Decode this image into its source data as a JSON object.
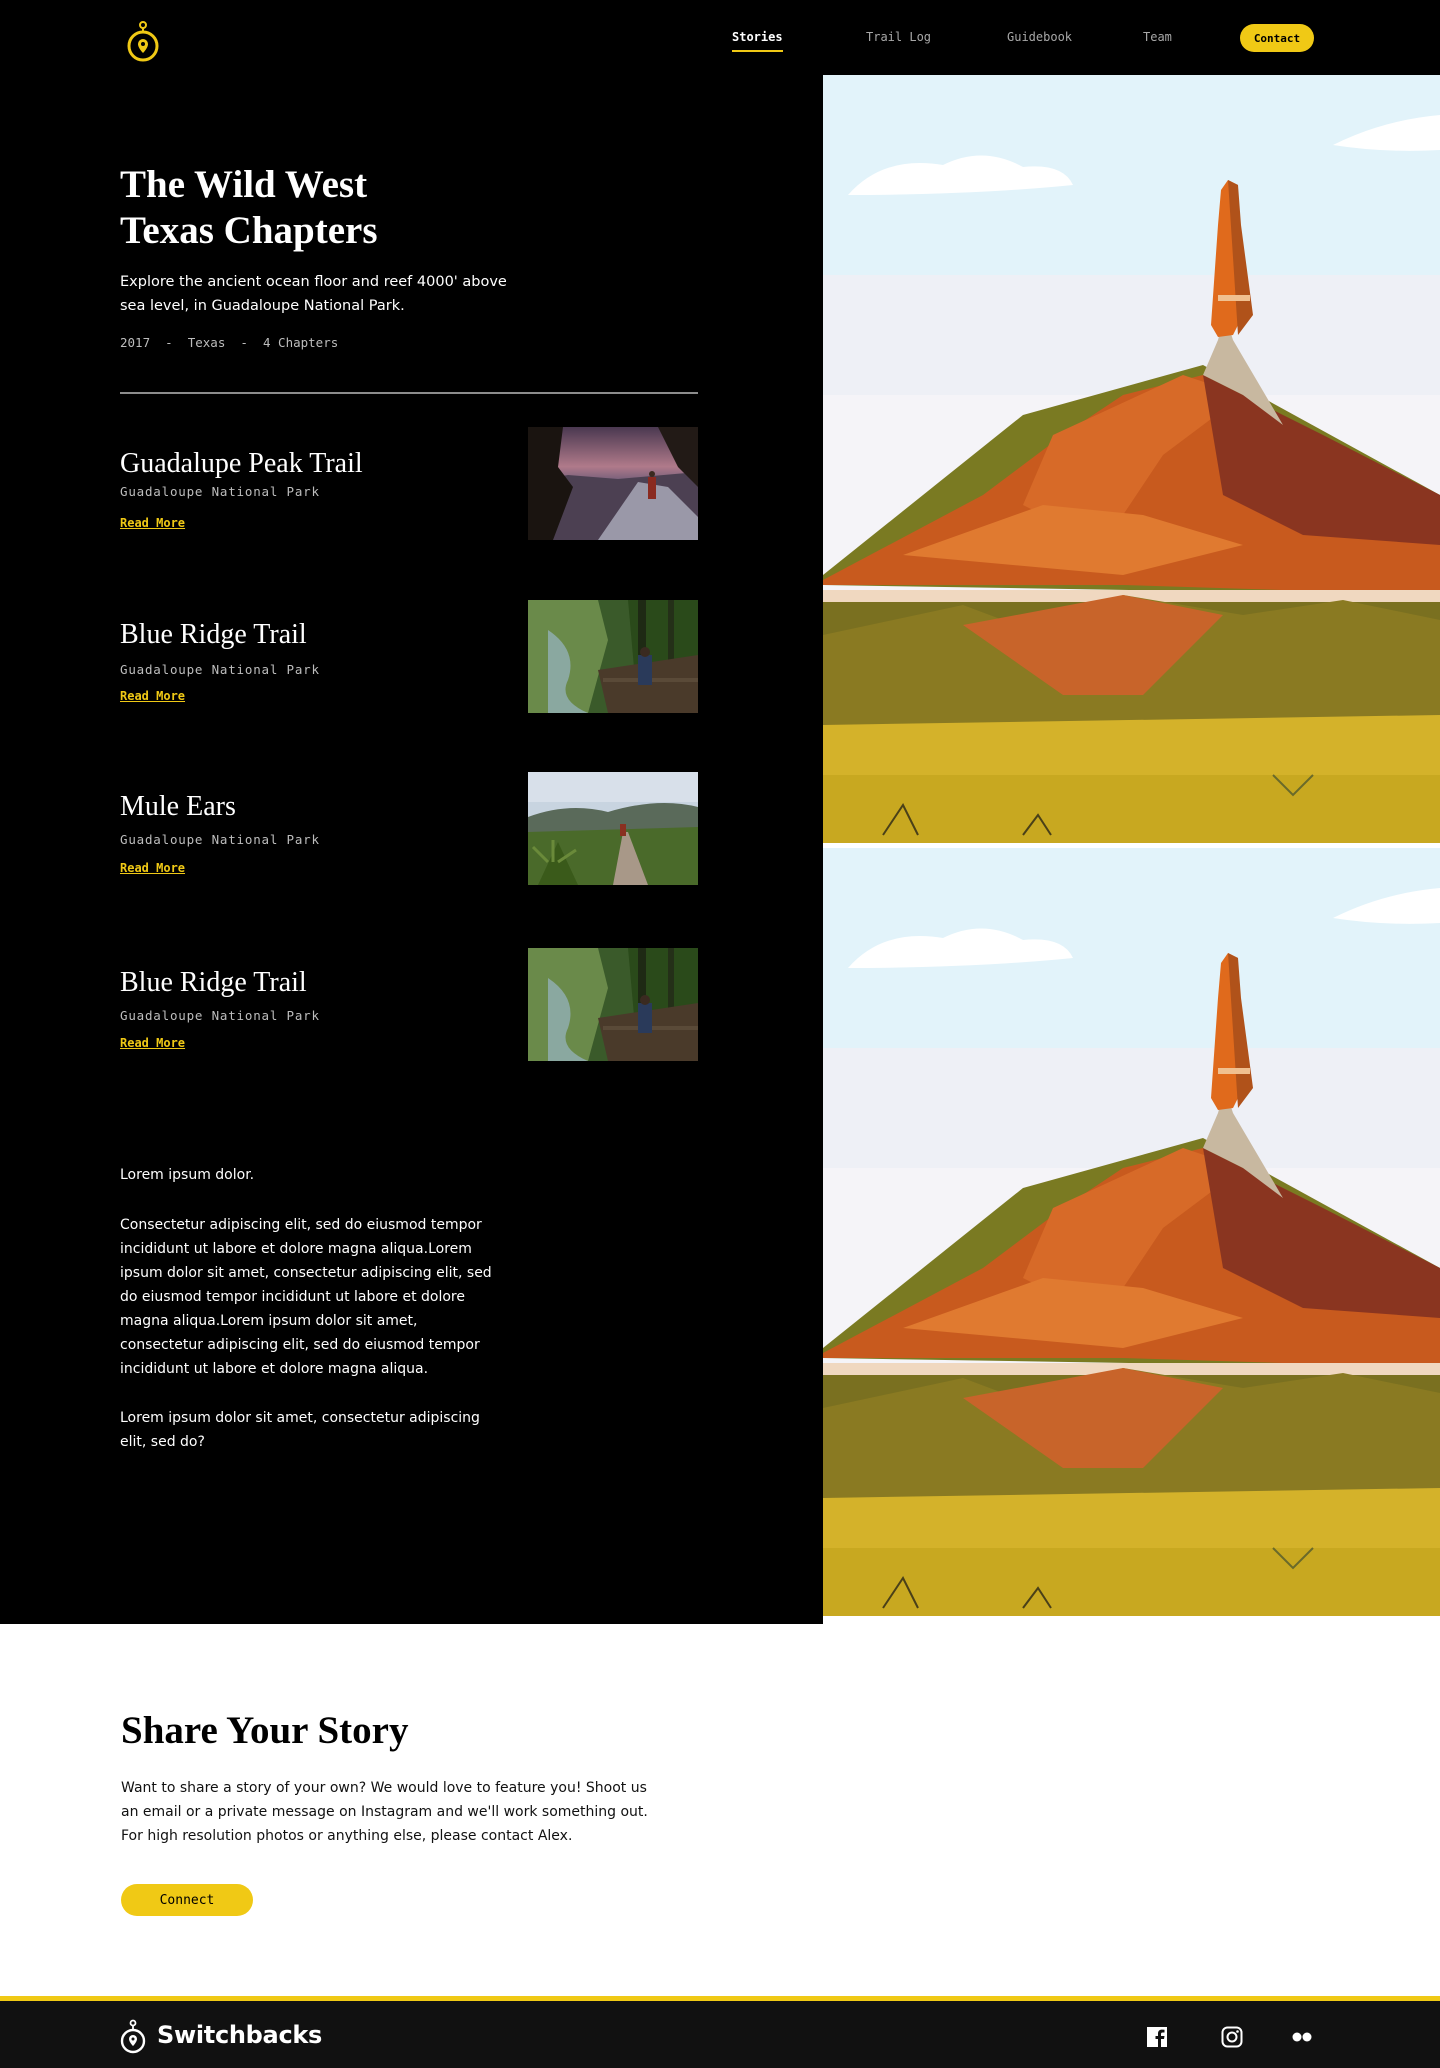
{
  "nav": {
    "items": [
      {
        "label": "Stories",
        "active": true
      },
      {
        "label": "Trail Log",
        "active": false
      },
      {
        "label": "Guidebook",
        "active": false
      },
      {
        "label": "Team",
        "active": false
      }
    ],
    "contact_label": "Contact"
  },
  "hero": {
    "title_line1": "The Wild West",
    "title_line2": "Texas Chapters",
    "description": "Explore the ancient ocean floor and reef 4000' above sea level, in Guadaloupe National Park.",
    "meta": "2017  -  Texas  -  4 Chapters"
  },
  "trails": [
    {
      "name": "Guadalupe Peak Trail",
      "park": "Guadaloupe National Park",
      "link": "Read More"
    },
    {
      "name": "Blue Ridge Trail",
      "park": "Guadaloupe National Park",
      "link": "Read More"
    },
    {
      "name": "Mule Ears",
      "park": "Guadaloupe National Park",
      "link": "Read More"
    },
    {
      "name": "Blue Ridge Trail",
      "park": "Guadaloupe National Park",
      "link": "Read More"
    }
  ],
  "body_copy": {
    "p1": "Lorem ipsum dolor.",
    "p2": "Consectetur adipiscing elit, sed do eiusmod tempor incididunt ut labore et dolore magna aliqua.Lorem ipsum dolor sit amet, consectetur adipiscing elit, sed do eiusmod tempor incididunt ut labore et dolore magna aliqua.Lorem ipsum dolor sit amet, consectetur adipiscing elit, sed do eiusmod tempor incididunt ut labore et dolore magna aliqua.",
    "p3": "Lorem ipsum dolor sit amet, consectetur adipiscing elit, sed do?"
  },
  "share": {
    "title": "Share Your Story",
    "text": "Want to share a story of your own? We would love to feature you! Shoot us an email or a private message on Instagram and we'll work something out. For high resolution photos or anything else, please contact Alex.",
    "button_label": "Connect"
  },
  "footer": {
    "brand": "Switchbacks",
    "social_icons": [
      "facebook-icon",
      "instagram-icon",
      "flickr-icon"
    ]
  },
  "colors": {
    "accent": "#f0c915",
    "background_dark": "#000000",
    "footer_bg": "#111111"
  }
}
